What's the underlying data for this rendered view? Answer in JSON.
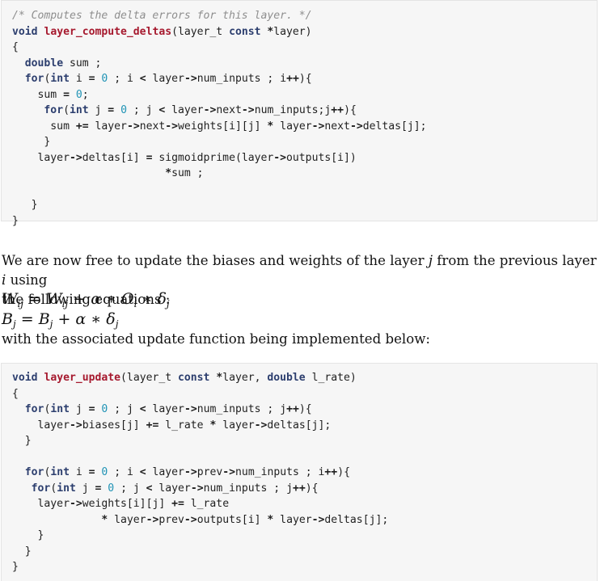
{
  "code_block_1": {
    "lines": [
      [
        {
          "c": "cmt",
          "t": "/* Computes the delta errors for this layer. */"
        }
      ],
      [
        {
          "c": "kw",
          "t": "void"
        },
        {
          "c": "",
          "t": " "
        },
        {
          "c": "fn",
          "t": "layer_compute_deltas"
        },
        {
          "c": "",
          "t": "(layer_t "
        },
        {
          "c": "kw",
          "t": "const"
        },
        {
          "c": "",
          "t": " "
        },
        {
          "c": "op",
          "t": "*"
        },
        {
          "c": "",
          "t": "layer)"
        }
      ],
      [
        {
          "c": "",
          "t": "{"
        }
      ],
      [
        {
          "c": "",
          "t": "  "
        },
        {
          "c": "kw",
          "t": "double"
        },
        {
          "c": "",
          "t": " sum ;"
        }
      ],
      [
        {
          "c": "",
          "t": "  "
        },
        {
          "c": "kw",
          "t": "for"
        },
        {
          "c": "",
          "t": "("
        },
        {
          "c": "kw",
          "t": "int"
        },
        {
          "c": "",
          "t": " i "
        },
        {
          "c": "op",
          "t": "="
        },
        {
          "c": "",
          "t": " "
        },
        {
          "c": "num",
          "t": "0"
        },
        {
          "c": "",
          "t": " ; i "
        },
        {
          "c": "op",
          "t": "<"
        },
        {
          "c": "",
          "t": " layer"
        },
        {
          "c": "op",
          "t": "->"
        },
        {
          "c": "",
          "t": "num_inputs ; i"
        },
        {
          "c": "op",
          "t": "++"
        },
        {
          "c": "",
          "t": "){"
        }
      ],
      [
        {
          "c": "",
          "t": "    sum "
        },
        {
          "c": "op",
          "t": "="
        },
        {
          "c": "",
          "t": " "
        },
        {
          "c": "num",
          "t": "0"
        },
        {
          "c": "",
          "t": ";"
        }
      ],
      [
        {
          "c": "",
          "t": "     "
        },
        {
          "c": "kw",
          "t": "for"
        },
        {
          "c": "",
          "t": "("
        },
        {
          "c": "kw",
          "t": "int"
        },
        {
          "c": "",
          "t": " j "
        },
        {
          "c": "op",
          "t": "="
        },
        {
          "c": "",
          "t": " "
        },
        {
          "c": "num",
          "t": "0"
        },
        {
          "c": "",
          "t": " ; j "
        },
        {
          "c": "op",
          "t": "<"
        },
        {
          "c": "",
          "t": " layer"
        },
        {
          "c": "op",
          "t": "->"
        },
        {
          "c": "",
          "t": "next"
        },
        {
          "c": "op",
          "t": "->"
        },
        {
          "c": "",
          "t": "num_inputs;j"
        },
        {
          "c": "op",
          "t": "++"
        },
        {
          "c": "",
          "t": "){"
        }
      ],
      [
        {
          "c": "",
          "t": "      sum "
        },
        {
          "c": "op",
          "t": "+="
        },
        {
          "c": "",
          "t": " layer"
        },
        {
          "c": "op",
          "t": "->"
        },
        {
          "c": "",
          "t": "next"
        },
        {
          "c": "op",
          "t": "->"
        },
        {
          "c": "",
          "t": "weights[i][j] "
        },
        {
          "c": "op",
          "t": "*"
        },
        {
          "c": "",
          "t": " layer"
        },
        {
          "c": "op",
          "t": "->"
        },
        {
          "c": "",
          "t": "next"
        },
        {
          "c": "op",
          "t": "->"
        },
        {
          "c": "",
          "t": "deltas[j];"
        }
      ],
      [
        {
          "c": "",
          "t": "     }"
        }
      ],
      [
        {
          "c": "",
          "t": "    layer"
        },
        {
          "c": "op",
          "t": "->"
        },
        {
          "c": "",
          "t": "deltas[i] "
        },
        {
          "c": "op",
          "t": "="
        },
        {
          "c": "",
          "t": " sigmoidprime(layer"
        },
        {
          "c": "op",
          "t": "->"
        },
        {
          "c": "",
          "t": "outputs[i])"
        }
      ],
      [
        {
          "c": "",
          "t": "                        "
        },
        {
          "c": "op",
          "t": "*"
        },
        {
          "c": "",
          "t": "sum ;"
        }
      ],
      [
        {
          "c": "",
          "t": ""
        }
      ],
      [
        {
          "c": "",
          "t": "   }"
        }
      ],
      [
        {
          "c": "",
          "t": "}"
        }
      ]
    ]
  },
  "prose": {
    "paragraph_1_before_j": "We are now free to update the biases and weights of the layer ",
    "var_j": "j",
    "paragraph_1_middle": " from the previous layer ",
    "var_i": "i",
    "paragraph_1_after_i": " using",
    "paragraph_1_line2": "the following equations :",
    "closing_line": "with the associated update function being implemented below:"
  },
  "equations": {
    "eq1": {
      "lhs": "W",
      "lhs_sub": "ij",
      "eq": " = ",
      "rhs1": "W",
      "rhs1_sub": "ij",
      "plus": " + ",
      "alpha": "α",
      "mul1": " ∗ ",
      "o": "O",
      "o_sub": "i",
      "mul2": " ∗ ",
      "delta": "δ",
      "delta_sub": "j"
    },
    "eq2": {
      "lhs": "B",
      "lhs_sub": "j",
      "eq": " = ",
      "rhs1": "B",
      "rhs1_sub": "j",
      "plus": " + ",
      "alpha": "α",
      "mul1": " ∗ ",
      "delta": "δ",
      "delta_sub": "j"
    }
  },
  "code_block_2": {
    "lines": [
      [
        {
          "c": "kw",
          "t": "void"
        },
        {
          "c": "",
          "t": " "
        },
        {
          "c": "fn",
          "t": "layer_update"
        },
        {
          "c": "",
          "t": "(layer_t "
        },
        {
          "c": "kw",
          "t": "const"
        },
        {
          "c": "",
          "t": " "
        },
        {
          "c": "op",
          "t": "*"
        },
        {
          "c": "",
          "t": "layer, "
        },
        {
          "c": "kw",
          "t": "double"
        },
        {
          "c": "",
          "t": " l_rate)"
        }
      ],
      [
        {
          "c": "",
          "t": "{"
        }
      ],
      [
        {
          "c": "",
          "t": "  "
        },
        {
          "c": "kw",
          "t": "for"
        },
        {
          "c": "",
          "t": "("
        },
        {
          "c": "kw",
          "t": "int"
        },
        {
          "c": "",
          "t": " j "
        },
        {
          "c": "op",
          "t": "="
        },
        {
          "c": "",
          "t": " "
        },
        {
          "c": "num",
          "t": "0"
        },
        {
          "c": "",
          "t": " ; j "
        },
        {
          "c": "op",
          "t": "<"
        },
        {
          "c": "",
          "t": " layer"
        },
        {
          "c": "op",
          "t": "->"
        },
        {
          "c": "",
          "t": "num_inputs ; j"
        },
        {
          "c": "op",
          "t": "++"
        },
        {
          "c": "",
          "t": "){"
        }
      ],
      [
        {
          "c": "",
          "t": "    layer"
        },
        {
          "c": "op",
          "t": "->"
        },
        {
          "c": "",
          "t": "biases[j] "
        },
        {
          "c": "op",
          "t": "+="
        },
        {
          "c": "",
          "t": " l_rate "
        },
        {
          "c": "op",
          "t": "*"
        },
        {
          "c": "",
          "t": " layer"
        },
        {
          "c": "op",
          "t": "->"
        },
        {
          "c": "",
          "t": "deltas[j];"
        }
      ],
      [
        {
          "c": "",
          "t": "  }"
        }
      ],
      [
        {
          "c": "",
          "t": ""
        }
      ],
      [
        {
          "c": "",
          "t": "  "
        },
        {
          "c": "kw",
          "t": "for"
        },
        {
          "c": "",
          "t": "("
        },
        {
          "c": "kw",
          "t": "int"
        },
        {
          "c": "",
          "t": " i "
        },
        {
          "c": "op",
          "t": "="
        },
        {
          "c": "",
          "t": " "
        },
        {
          "c": "num",
          "t": "0"
        },
        {
          "c": "",
          "t": " ; i "
        },
        {
          "c": "op",
          "t": "<"
        },
        {
          "c": "",
          "t": " layer"
        },
        {
          "c": "op",
          "t": "->"
        },
        {
          "c": "",
          "t": "prev"
        },
        {
          "c": "op",
          "t": "->"
        },
        {
          "c": "",
          "t": "num_inputs ; i"
        },
        {
          "c": "op",
          "t": "++"
        },
        {
          "c": "",
          "t": "){"
        }
      ],
      [
        {
          "c": "",
          "t": "   "
        },
        {
          "c": "kw",
          "t": "for"
        },
        {
          "c": "",
          "t": "("
        },
        {
          "c": "kw",
          "t": "int"
        },
        {
          "c": "",
          "t": " j "
        },
        {
          "c": "op",
          "t": "="
        },
        {
          "c": "",
          "t": " "
        },
        {
          "c": "num",
          "t": "0"
        },
        {
          "c": "",
          "t": " ; j "
        },
        {
          "c": "op",
          "t": "<"
        },
        {
          "c": "",
          "t": " layer"
        },
        {
          "c": "op",
          "t": "->"
        },
        {
          "c": "",
          "t": "num_inputs ; j"
        },
        {
          "c": "op",
          "t": "++"
        },
        {
          "c": "",
          "t": "){"
        }
      ],
      [
        {
          "c": "",
          "t": "    layer"
        },
        {
          "c": "op",
          "t": "->"
        },
        {
          "c": "",
          "t": "weights[i][j] "
        },
        {
          "c": "op",
          "t": "+="
        },
        {
          "c": "",
          "t": " l_rate"
        }
      ],
      [
        {
          "c": "",
          "t": "              "
        },
        {
          "c": "op",
          "t": "*"
        },
        {
          "c": "",
          "t": " layer"
        },
        {
          "c": "op",
          "t": "->"
        },
        {
          "c": "",
          "t": "prev"
        },
        {
          "c": "op",
          "t": "->"
        },
        {
          "c": "",
          "t": "outputs[i] "
        },
        {
          "c": "op",
          "t": "*"
        },
        {
          "c": "",
          "t": " layer"
        },
        {
          "c": "op",
          "t": "->"
        },
        {
          "c": "",
          "t": "deltas[j];"
        }
      ],
      [
        {
          "c": "",
          "t": "    }"
        }
      ],
      [
        {
          "c": "",
          "t": "  }"
        }
      ],
      [
        {
          "c": "",
          "t": "}"
        }
      ]
    ]
  }
}
